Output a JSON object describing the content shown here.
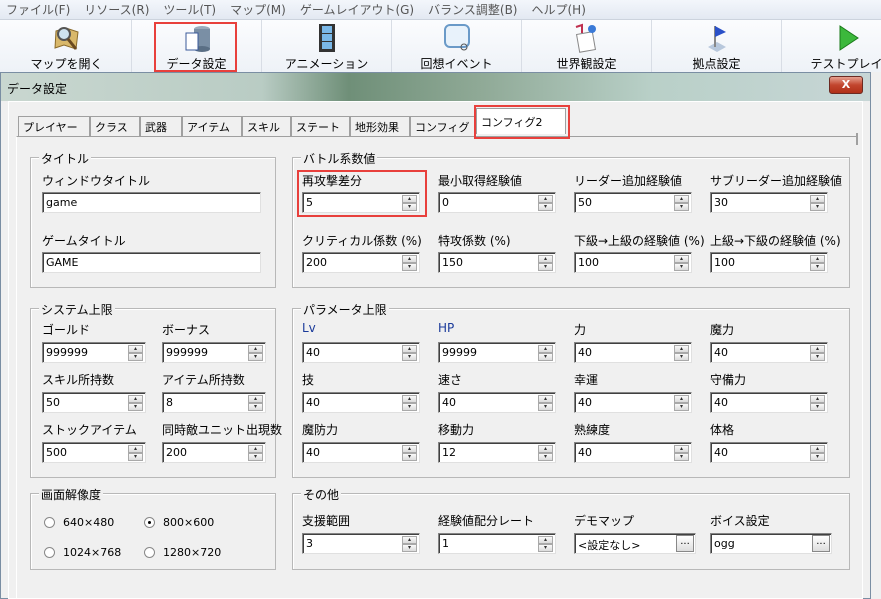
{
  "menu": [
    "ファイル(F)",
    "リソース(R)",
    "ツール(T)",
    "マップ(M)",
    "ゲームレイアウト(G)",
    "バランス調整(B)",
    "ヘルプ(H)"
  ],
  "toolbar": [
    {
      "label": "マップを開く",
      "icon": "map-magnifier-icon"
    },
    {
      "label": "データ設定",
      "icon": "database-icon",
      "highlighted": true
    },
    {
      "label": "アニメーション",
      "icon": "film-icon"
    },
    {
      "label": "回想イベント",
      "icon": "recollection-icon"
    },
    {
      "label": "世界観設定",
      "icon": "world-settings-icon"
    },
    {
      "label": "拠点設定",
      "icon": "flag-icon"
    },
    {
      "label": "テストプレイ",
      "icon": "play-icon"
    }
  ],
  "dialog": {
    "title": "データ設定",
    "close": "X"
  },
  "tabs": [
    "プレイヤー",
    "クラス",
    "武器",
    "アイテム",
    "スキル",
    "ステート",
    "地形効果",
    "コンフィグ",
    "コンフィグ2"
  ],
  "active_tab": 8,
  "groups": {
    "title": {
      "label": "タイトル",
      "fields": [
        {
          "label": "ウィンドウタイトル",
          "value": "game"
        },
        {
          "label": "ゲームタイトル",
          "value": "GAME"
        }
      ]
    },
    "battle": {
      "label": "バトル系数値",
      "fields": [
        {
          "label": "再攻撃差分",
          "value": "5"
        },
        {
          "label": "最小取得経験値",
          "value": "0"
        },
        {
          "label": "リーダー追加経験値",
          "value": "50"
        },
        {
          "label": "サブリーダー追加経験値",
          "value": "30"
        },
        {
          "label": "クリティカル係数 (%)",
          "value": "200"
        },
        {
          "label": "特攻係数 (%)",
          "value": "150"
        },
        {
          "label": "下級→上級の経験値 (%)",
          "value": "100"
        },
        {
          "label": "上級→下級の経験値 (%)",
          "value": "100"
        }
      ]
    },
    "system": {
      "label": "システム上限",
      "fields": [
        {
          "label": "ゴールド",
          "value": "999999"
        },
        {
          "label": "ボーナス",
          "value": "999999"
        },
        {
          "label": "スキル所持数",
          "value": "50"
        },
        {
          "label": "アイテム所持数",
          "value": "8"
        },
        {
          "label": "ストックアイテム",
          "value": "500"
        },
        {
          "label": "同時敵ユニット出現数",
          "value": "200"
        }
      ]
    },
    "params": {
      "label": "パラメータ上限",
      "fields": [
        {
          "label": "Lv",
          "value": "40"
        },
        {
          "label": "HP",
          "value": "99999"
        },
        {
          "label": "力",
          "value": "40"
        },
        {
          "label": "魔力",
          "value": "40"
        },
        {
          "label": "技",
          "value": "40"
        },
        {
          "label": "速さ",
          "value": "40"
        },
        {
          "label": "幸運",
          "value": "40"
        },
        {
          "label": "守備力",
          "value": "40"
        },
        {
          "label": "魔防力",
          "value": "40"
        },
        {
          "label": "移動力",
          "value": "12"
        },
        {
          "label": "熟練度",
          "value": "40"
        },
        {
          "label": "体格",
          "value": "40"
        }
      ]
    },
    "resolution": {
      "label": "画面解像度",
      "options": [
        "640×480",
        "800×600",
        "1024×768",
        "1280×720"
      ],
      "selected": 1
    },
    "other": {
      "label": "その他",
      "fields": [
        {
          "label": "支援範囲",
          "value": "3",
          "kind": "spin"
        },
        {
          "label": "経験値配分レート",
          "value": "1",
          "kind": "spin"
        },
        {
          "label": "デモマップ",
          "value": "<設定なし>",
          "kind": "browse"
        },
        {
          "label": "ボイス設定",
          "value": "ogg",
          "kind": "browse"
        }
      ]
    }
  },
  "colors": {
    "highlight": "#e8403c",
    "blue_label": "#1a3a9a"
  }
}
